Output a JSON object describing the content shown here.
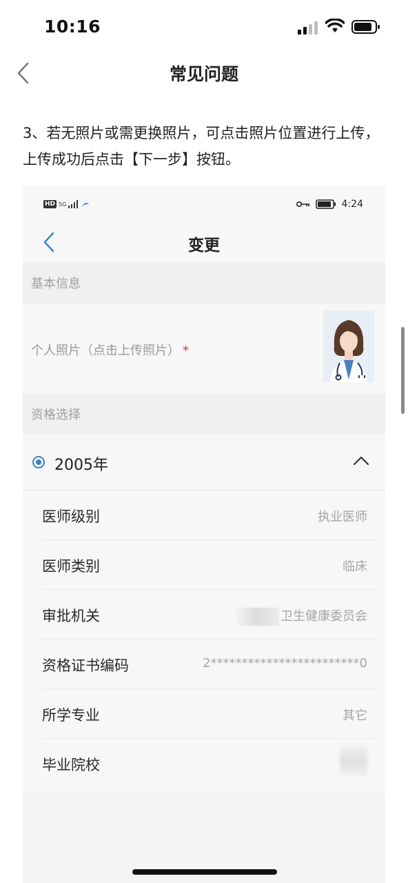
{
  "status_bar": {
    "time": "10:16"
  },
  "nav": {
    "title": "常见问题"
  },
  "instruction": "3、若无照片或需更换照片，可点击照片位置进行上传，上传成功后点击【下一步】按钮。",
  "screenshot": {
    "status": {
      "hd": "HD",
      "net": "5G",
      "time": "4:24"
    },
    "title": "变更",
    "section_basic": "基本信息",
    "photo_label": "个人照片（点击上传照片）",
    "required_mark": "*",
    "section_qual": "资格选择",
    "year": "2005年",
    "rows": [
      {
        "label": "医师级别",
        "value": "执业医师"
      },
      {
        "label": "医师类别",
        "value": "临床"
      },
      {
        "label": "审批机关",
        "value": "卫生健康委员会"
      },
      {
        "label": "资格证书编码",
        "value": "2************************0"
      },
      {
        "label": "所学专业",
        "value": "其它"
      },
      {
        "label": "毕业院校",
        "value": ""
      }
    ]
  },
  "colors": {
    "accent": "#3b82c4",
    "required": "#e0302a"
  }
}
